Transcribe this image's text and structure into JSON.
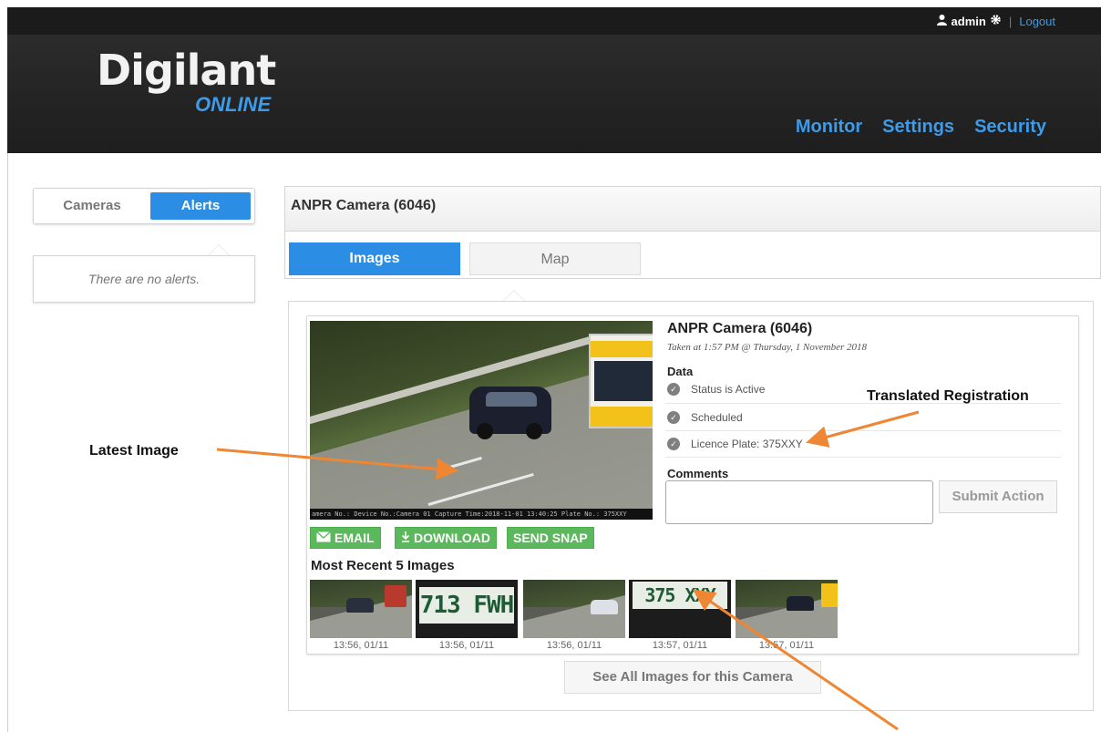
{
  "header": {
    "user": "admin",
    "logout": "Logout",
    "logo_main": "Digilant",
    "logo_sub": "ONLINE",
    "nav": [
      "Monitor",
      "Settings",
      "Security"
    ]
  },
  "sidebar": {
    "tabs": [
      "Cameras",
      "Alerts"
    ],
    "active_tab": "Alerts",
    "empty_text": "There are no alerts."
  },
  "main": {
    "panel_title": "ANPR Camera (6046)",
    "tabs": [
      "Images",
      "Map"
    ],
    "active_tab": "Images"
  },
  "image_info": {
    "title": "ANPR Camera (6046)",
    "taken": "Taken at 1:57 PM @ Thursday, 1 November 2018",
    "data_label": "Data",
    "data_rows": [
      "Status is Active",
      "Scheduled",
      "Licence Plate: 375XXY"
    ],
    "comments_label": "Comments",
    "submit_label": "Submit Action"
  },
  "latest_image": {
    "stamp": "amera No.: Device No.:Camera 01 Capture Time:2018-11-01 13:40:25  Plate No.: 375XXY"
  },
  "actions": {
    "email": "EMAIL",
    "download": "DOWNLOAD",
    "snap": "SEND SNAP"
  },
  "recent": {
    "title": "Most Recent 5 Images",
    "thumbs": [
      {
        "kind": "scene",
        "caption": "13:56, 01/11"
      },
      {
        "kind": "plate",
        "plate": "713 FWH",
        "caption": "13:56, 01/11"
      },
      {
        "kind": "scene",
        "caption": "13:56, 01/11"
      },
      {
        "kind": "plate",
        "plate": "375 XXY",
        "caption": "13:57, 01/11"
      },
      {
        "kind": "scene",
        "caption": "13:57, 01/11"
      }
    ],
    "see_all": "See All Images for this Camera"
  },
  "annotations": {
    "latest": "Latest  Image",
    "translated": "Translated Registration"
  },
  "colors": {
    "accent_blue": "#2b8de3",
    "nav_blue": "#3d9be9",
    "action_green": "#5cb85c",
    "arrow_orange": "#ee8633"
  }
}
